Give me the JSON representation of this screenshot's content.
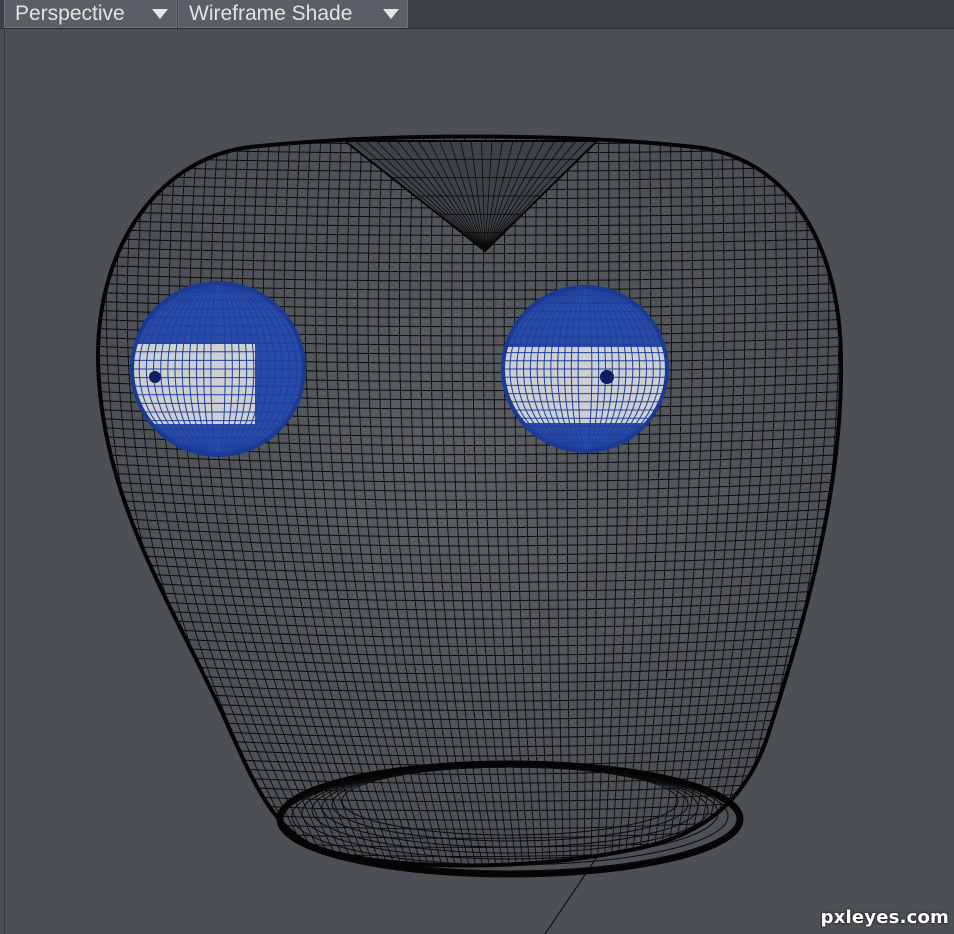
{
  "toolbar": {
    "view_mode": "Perspective",
    "shading_mode": "Wireframe Shade"
  },
  "watermark": "pxleyes.com",
  "colors": {
    "viewport_background": "#4c4f54",
    "mesh_wire": "#0a0a0a",
    "eye_wire": "#1d3e9a",
    "eye_white": "#c9c9cb"
  },
  "icons": {
    "dropdown": "chevron-down-icon"
  }
}
